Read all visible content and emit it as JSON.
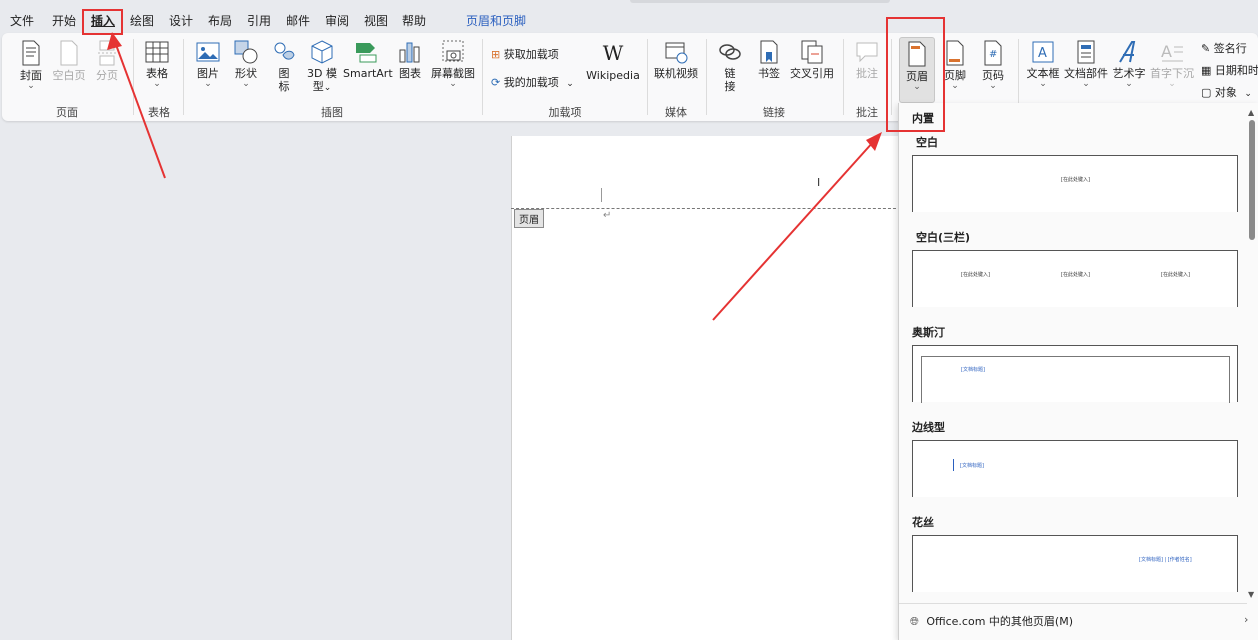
{
  "menubar": {
    "tabs": [
      "文件",
      "开始",
      "插入",
      "绘图",
      "设计",
      "布局",
      "引用",
      "邮件",
      "审阅",
      "视图",
      "帮助"
    ],
    "context_tab": "页眉和页脚"
  },
  "ribbon": {
    "page": {
      "cover": "封面",
      "blank_page": "空白页",
      "page_break": "分页",
      "group": "页面"
    },
    "table": {
      "table": "表格",
      "group": "表格"
    },
    "illustrations": {
      "picture": "图片",
      "shapes": "形状",
      "icons_1": "图",
      "icons_2": "标",
      "model_1": "3D 模",
      "model_2": "型",
      "smartart": "SmartArt",
      "chart": "图表",
      "screenshot": "屏幕截图",
      "group": "插图"
    },
    "addins": {
      "get_addins": "获取加载项",
      "my_addins": "我的加载项",
      "wikipedia": "Wikipedia",
      "group": "加载项"
    },
    "media": {
      "online_video": "联机视频",
      "group": "媒体"
    },
    "links": {
      "link_1": "链",
      "link_2": "接",
      "bookmark": "书签",
      "cross_ref": "交叉引用",
      "group": "链接"
    },
    "comments": {
      "comment": "批注",
      "group": "批注"
    },
    "header_footer": {
      "header": "页眉",
      "footer": "页脚",
      "page_number": "页码"
    },
    "text": {
      "textbox": "文本框",
      "quick_parts": "文档部件",
      "wordart": "艺术字",
      "dropcap": "首字下沉",
      "signature_line": "签名行",
      "date_time": "日期和时",
      "object": "对象"
    }
  },
  "document": {
    "header_tag": "页眉",
    "return_mark": "↵"
  },
  "dropdown": {
    "builtin_title": "内置",
    "items": [
      {
        "name": "空白",
        "placeholders": [
          "[在此处键入]"
        ]
      },
      {
        "name": "空白(三栏)",
        "placeholders": [
          "[在此处键入]",
          "[在此处键入]",
          "[在此处键入]"
        ]
      },
      {
        "name": "奥斯汀",
        "placeholders": [
          "[文档标题]"
        ]
      },
      {
        "name": "边线型",
        "placeholders": [
          "[文档标题]"
        ]
      },
      {
        "name": "花丝",
        "placeholders": [
          "[文档标题] | [作者姓名]"
        ]
      }
    ],
    "more_headers": "Office.com 中的其他页眉(M)"
  },
  "colors": {
    "accent": "#2a5fbf",
    "annotation": "#e53333"
  }
}
